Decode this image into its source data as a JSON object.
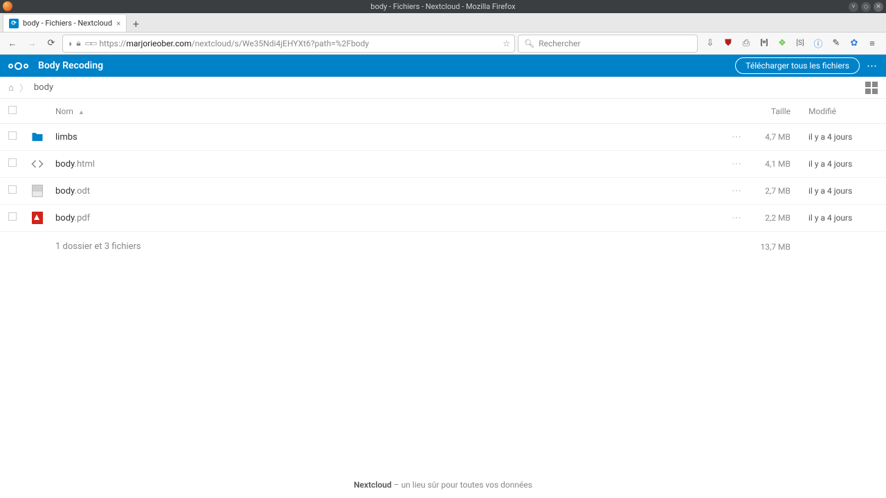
{
  "os": {
    "window_title": "body - Fichiers - Nextcloud - Mozilla Firefox"
  },
  "browser": {
    "tab_title": "body - Fichiers - Nextcloud",
    "url_scheme": "https://",
    "url_domain": "marjorieober.com",
    "url_path": "/nextcloud/s/We35Ndi4jEHYXt6?path=%2Fbody",
    "search_placeholder": "Rechercher"
  },
  "nc": {
    "brand": "Body Recoding",
    "download_all": "Télécharger tous les fichiers",
    "crumb_current": "body",
    "columns": {
      "name": "Nom",
      "size": "Taille",
      "modified": "Modifié"
    },
    "files": [
      {
        "icon": "folder",
        "name": "limbs",
        "ext": "",
        "size": "4,7 MB",
        "modified": "il y a 4 jours"
      },
      {
        "icon": "code",
        "name": "body",
        "ext": ".html",
        "size": "4,1 MB",
        "modified": "il y a 4 jours"
      },
      {
        "icon": "doc",
        "name": "body",
        "ext": ".odt",
        "size": "2,7 MB",
        "modified": "il y a 4 jours"
      },
      {
        "icon": "pdf",
        "name": "body",
        "ext": ".pdf",
        "size": "2,2 MB",
        "modified": "il y a 4 jours"
      }
    ],
    "summary": {
      "text": "1 dossier et 3 fichiers",
      "total_size": "13,7 MB"
    },
    "footer": {
      "brand": "Nextcloud",
      "tagline": " – un lieu sûr pour toutes vos données"
    }
  }
}
